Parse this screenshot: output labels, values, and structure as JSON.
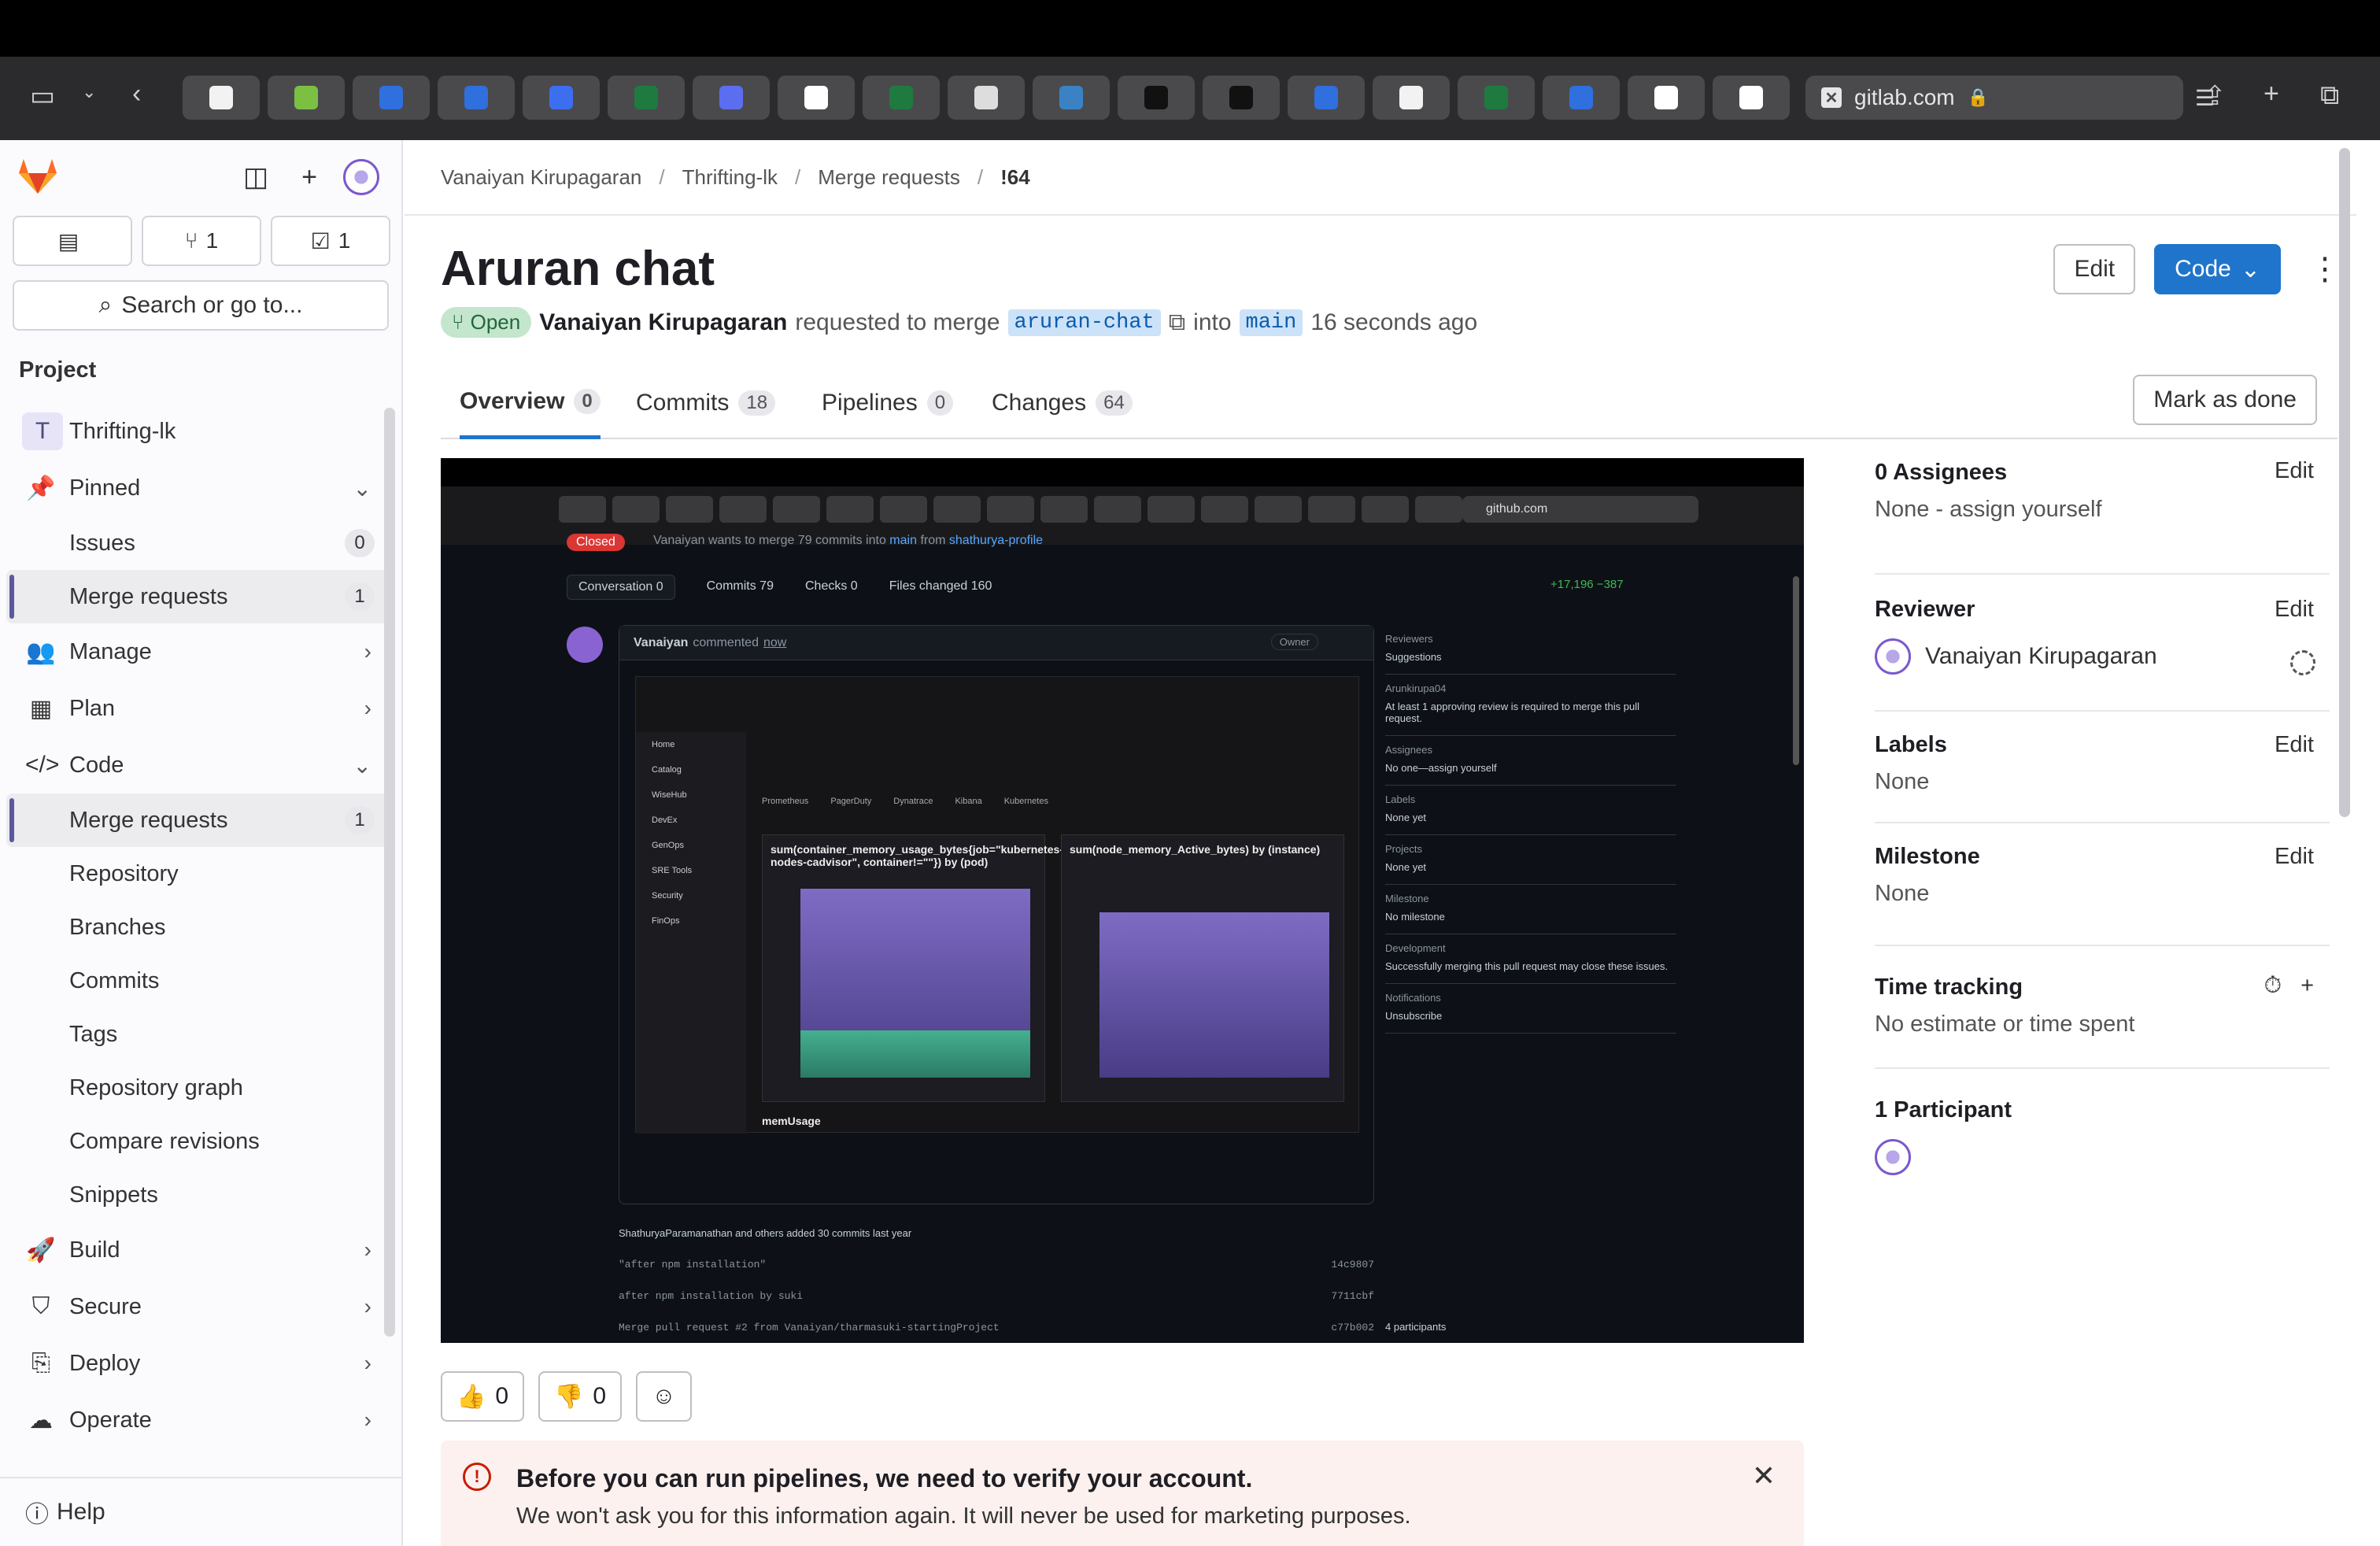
{
  "browser": {
    "url": "gitlab.com",
    "tab_colors": [
      "#f2f2f2",
      "#7bc043",
      "#2f6fde",
      "#2f6fde",
      "#3c6ef0",
      "#1f7a3f",
      "#5b6ef0",
      "#ffffff",
      "#1f7a3f",
      "#dddddd",
      "#3b82c4",
      "#111111",
      "#111111",
      "#2f6fde",
      "#f2f2f2",
      "#1f7a3f",
      "#2f6fde",
      "#ffffff",
      "#ffffff"
    ]
  },
  "sidebar": {
    "counters": {
      "issues": "",
      "merge_requests": "1",
      "todos": "1"
    },
    "search_label": "Search or go to...",
    "section_label": "Project",
    "project": {
      "initial": "T",
      "name": "Thrifting-lk"
    },
    "pinned": {
      "label": "Pinned",
      "items": [
        {
          "label": "Issues",
          "count": "0"
        },
        {
          "label": "Merge requests",
          "count": "1"
        }
      ]
    },
    "groups": [
      {
        "label": "Manage"
      },
      {
        "label": "Plan"
      }
    ],
    "code": {
      "label": "Code",
      "items": [
        {
          "label": "Merge requests",
          "count": "1"
        },
        {
          "label": "Repository"
        },
        {
          "label": "Branches"
        },
        {
          "label": "Commits"
        },
        {
          "label": "Tags"
        },
        {
          "label": "Repository graph"
        },
        {
          "label": "Compare revisions"
        },
        {
          "label": "Snippets"
        }
      ]
    },
    "lower_groups": [
      {
        "label": "Build"
      },
      {
        "label": "Secure"
      },
      {
        "label": "Deploy"
      },
      {
        "label": "Operate"
      }
    ],
    "help_label": "Help"
  },
  "breadcrumb": [
    "Vanaiyan Kirupagaran",
    "Thrifting-lk",
    "Merge requests",
    "!64"
  ],
  "mr": {
    "title": "Aruran chat",
    "status": "Open",
    "author": "Vanaiyan Kirupagaran",
    "requested_text": "requested to merge",
    "source_branch": "aruran-chat",
    "into_text": "into",
    "target_branch": "main",
    "time": "16 seconds ago",
    "edit_label": "Edit",
    "code_label": "Code",
    "mark_done_label": "Mark as done",
    "tabs": [
      {
        "label": "Overview",
        "count": "0"
      },
      {
        "label": "Commits",
        "count": "18"
      },
      {
        "label": "Pipelines",
        "count": "0"
      },
      {
        "label": "Changes",
        "count": "64"
      }
    ]
  },
  "embed": {
    "url": "github.com",
    "closed_label": "Closed",
    "subtitle_a": "Vanaiyan wants to merge 79 commits into",
    "subtitle_branch_a": "main",
    "subtitle_from": "from",
    "subtitle_branch_b": "shathurya-profile",
    "tabs": [
      "Conversation 0",
      "Commits 79",
      "Checks 0",
      "Files changed 160"
    ],
    "diffstat": "+17,196 −387",
    "comment_author": "Vanaiyan",
    "comment_text": "commented",
    "comment_when": "now",
    "owner_label": "Owner",
    "inner_nav": [
      "Home",
      "Catalog",
      "WiseHub",
      "DevEx",
      "GenOps",
      "SRE Tools",
      "Security",
      "FinOps"
    ],
    "inner_tabs": [
      "Prometheus",
      "PagerDuty",
      "Dynatrace",
      "Kibana",
      "Kubernetes"
    ],
    "chart1_title": "sum(container_memory_usage_bytes{job=\"kubernetes-nodes-cadvisor\", container!=\"\"}) by (pod)",
    "chart2_title": "sum(node_memory_Active_bytes) by (instance)",
    "mem_label": "memUsage",
    "right": [
      {
        "h": "Reviewers",
        "v": "Suggestions"
      },
      {
        "h": "Arunkirupa04",
        "v": "At least 1 approving review is required to merge this pull request."
      },
      {
        "h": "Assignees",
        "v": "No one—assign yourself"
      },
      {
        "h": "Labels",
        "v": "None yet"
      },
      {
        "h": "Projects",
        "v": "None yet"
      },
      {
        "h": "Milestone",
        "v": "No milestone"
      },
      {
        "h": "Development",
        "v": "Successfully merging this pull request may close these issues."
      },
      {
        "h": "Notifications",
        "v": "Unsubscribe"
      }
    ],
    "commit_summary": "ShathuryaParamanathan and others added 30 commits last year",
    "commits": [
      {
        "msg": "\"after npm installation\"",
        "sha": "14c9807"
      },
      {
        "msg": "after npm installation by suki",
        "sha": "7711cbf"
      },
      {
        "msg": "Merge pull request #2 from Vanaiyan/tharmasuki-startingProject",
        "sha": "c77b002"
      }
    ],
    "participants": "4 participants"
  },
  "reactions": {
    "thumbs_up": "0",
    "thumbs_down": "0"
  },
  "alert": {
    "title": "Before you can run pipelines, we need to verify your account.",
    "body": "We won't ask you for this information again. It will never be used for marketing purposes."
  },
  "right_sidebar": {
    "assignees_title": "0 Assignees",
    "assignees_value": "None - assign yourself",
    "reviewer_title": "Reviewer",
    "reviewer_name": "Vanaiyan Kirupagaran",
    "labels_title": "Labels",
    "labels_value": "None",
    "milestone_title": "Milestone",
    "milestone_value": "None",
    "time_title": "Time tracking",
    "time_value": "No estimate or time spent",
    "participants_title": "1 Participant",
    "edit_label": "Edit"
  }
}
